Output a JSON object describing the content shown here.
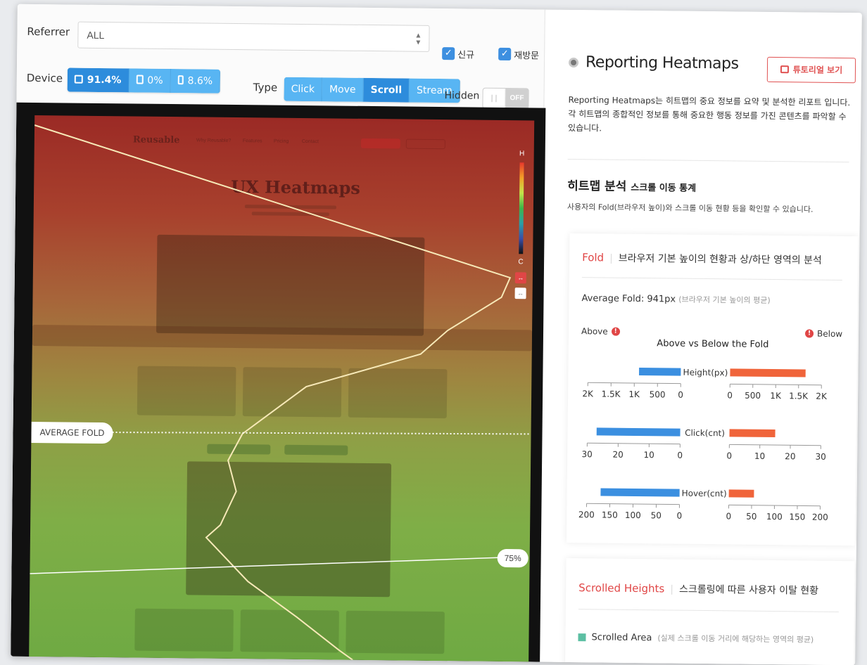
{
  "filters": {
    "referrer_label": "Referrer",
    "referrer_value": "ALL",
    "new_label": "신규",
    "return_label": "재방문",
    "device_label": "Device",
    "devices": [
      {
        "value": "91.4%",
        "icon": "desktop-icon",
        "active": true
      },
      {
        "value": "0%",
        "icon": "tablet-icon",
        "active": false
      },
      {
        "value": "8.6%",
        "icon": "mobile-icon",
        "active": false
      }
    ],
    "type_label": "Type",
    "types": [
      {
        "label": "Click",
        "active": false
      },
      {
        "label": "Move",
        "active": false
      },
      {
        "label": "Scroll",
        "active": true
      },
      {
        "label": "Stream",
        "active": false
      }
    ],
    "hidden_label": "Hidden",
    "hidden_state": "OFF",
    "hidden_knob": "| |"
  },
  "heatmap": {
    "page_logo": "Reusable",
    "page_nav": [
      "Why Reusable?",
      "Features",
      "Pricing",
      "Contact"
    ],
    "page_title": "UX Heatmaps",
    "scale_top": "H",
    "scale_bottom": "C",
    "average_fold_label": "AVERAGE FOLD",
    "pct_label": "75%"
  },
  "report": {
    "title": "Reporting Heatmaps",
    "tutorial_button": "튜토리얼 보기",
    "description": "Reporting Heatmaps는 히트맵의 중요 정보를 요약 및 분석한 리포트 입니다. 각 히트맵의 종합적인 정보를 통해 중요한 행동 정보를 가진 콘텐츠를 파악할 수 있습니다.",
    "section_title": "히트맵 분석",
    "section_subtitle": "스크롤 이동 통계",
    "section_desc": "사용자의 Fold(브라우저 높이)와 스크롤 이동 현황 등을 확인할 수 있습니다.",
    "fold_card": {
      "title": "Fold",
      "subtitle": "브라우저 기본 높이의 현황과 상/하단 영역의 분석",
      "avg_fold": "Average Fold: 941px",
      "avg_fold_note": "(브라우저 기본 높이의 평균)",
      "above_label": "Above",
      "below_label": "Below",
      "info_glyph": "!"
    },
    "scrolled_card": {
      "title": "Scrolled Heights",
      "subtitle": "스크롤링에 따른 사용자 이탈 현황",
      "legend_label": "Scrolled Area",
      "legend_note": "(실제 스크롤 이동 거리에 해당하는 영역의 평균)"
    }
  },
  "colors": {
    "above": "#3b8fe0",
    "below": "#f0643a",
    "accent": "#e04646"
  },
  "chart_data": {
    "type": "bar",
    "title": "Above vs Below the Fold",
    "series_names": [
      "Above",
      "Below"
    ],
    "groups": [
      {
        "label": "Height(px)",
        "above": 900,
        "below": 1650,
        "max": 2000,
        "ticks": [
          "0",
          "500",
          "1K",
          "1.5K",
          "2K"
        ],
        "left_ticks": [
          "2K",
          "1.5K",
          "1K",
          "500",
          "0"
        ]
      },
      {
        "label": "Click(cnt)",
        "above": 27,
        "below": 15,
        "max": 30,
        "ticks": [
          "0",
          "10",
          "20",
          "30"
        ],
        "left_ticks": [
          "30",
          "20",
          "10",
          "0"
        ]
      },
      {
        "label": "Hover(cnt)",
        "above": 170,
        "below": 55,
        "max": 200,
        "ticks": [
          "0",
          "50",
          "100",
          "150",
          "200"
        ],
        "left_ticks": [
          "200",
          "150",
          "100",
          "50",
          "0"
        ]
      }
    ]
  }
}
